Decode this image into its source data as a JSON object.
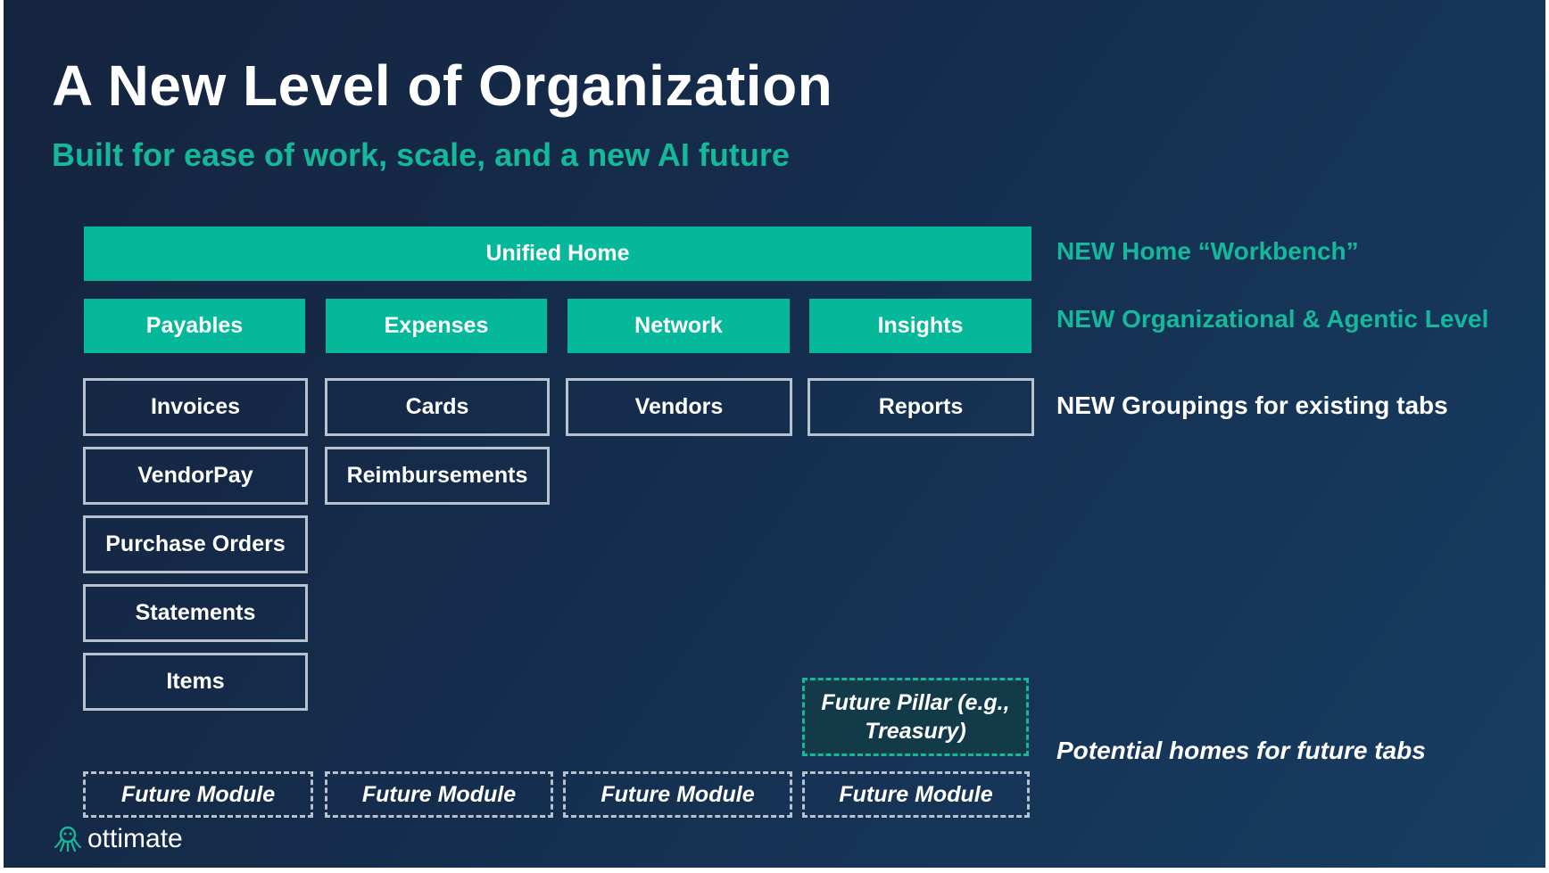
{
  "title": "A New Level of Organization",
  "subtitle": "Built for ease of work, scale, and a new AI future",
  "unified_home": "Unified Home",
  "pillars": [
    "Payables",
    "Expenses",
    "Network",
    "Insights"
  ],
  "groupings": {
    "payables": [
      "Invoices",
      "VendorPay",
      "Purchase Orders",
      "Statements",
      "Items"
    ],
    "expenses": [
      "Cards",
      "Reimbursements"
    ],
    "network": [
      "Vendors"
    ],
    "insights": [
      "Reports"
    ]
  },
  "future_pillar": "Future Pillar (e.g., Treasury)",
  "future_modules": [
    "Future Module",
    "Future Module",
    "Future Module",
    "Future Module"
  ],
  "notes": {
    "home": "NEW Home “Workbench”",
    "organizational": "NEW Organizational & Agentic Level",
    "groupings": "NEW Groupings for existing tabs",
    "future": "Potential homes for future tabs"
  },
  "logo": {
    "text": "ottimate",
    "icon": "octopus-icon"
  },
  "colors": {
    "accent": "#05b89a",
    "background": "#152d4d",
    "outline": "#b8c2cf"
  }
}
